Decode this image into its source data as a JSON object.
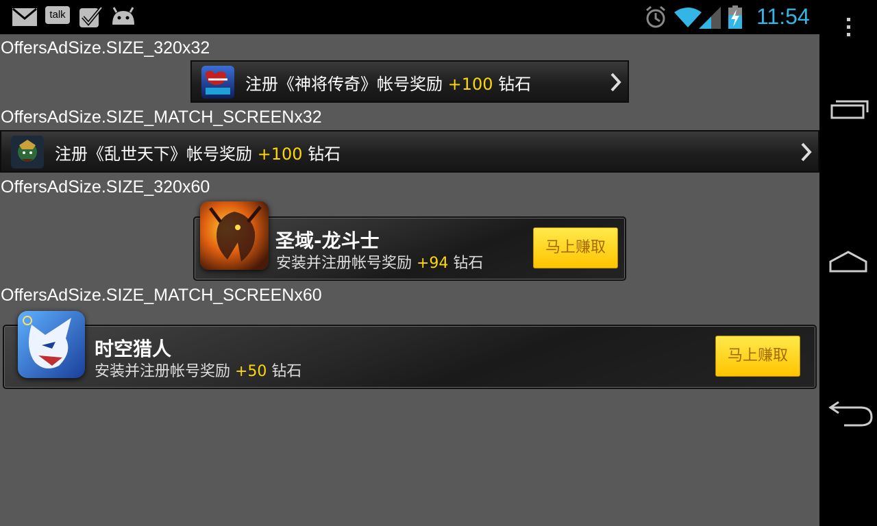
{
  "statusbar": {
    "talk_label": "talk",
    "time": "11:54",
    "icons": [
      "mail-icon",
      "talk-icon",
      "check-icon",
      "android-icon",
      "alarm-icon",
      "wifi-icon",
      "signal-icon",
      "battery-charging-icon"
    ]
  },
  "navbar": {
    "icons": [
      "overflow-menu-icon",
      "recent-apps-icon",
      "home-icon",
      "back-icon"
    ]
  },
  "sections": [
    {
      "label": "OffersAdSize.SIZE_320x32",
      "ad": {
        "prefix": "注册《神将传奇》帐号奖励 ",
        "reward": "+100",
        "suffix": " 钻石",
        "icon": "game-icon-shenjiang"
      }
    },
    {
      "label": "OffersAdSize.SIZE_MATCH_SCREENx32",
      "ad": {
        "prefix": "注册《乱世天下》帐号奖励 ",
        "reward": "+100",
        "suffix": " 钻石",
        "icon": "game-icon-luanshi"
      }
    },
    {
      "label": "OffersAdSize.SIZE_320x60",
      "ad": {
        "title": "圣域-龙斗士",
        "sub_prefix": "安装并注册帐号奖励 ",
        "reward": "+94",
        "sub_suffix": " 钻石",
        "button": "马上赚取",
        "icon": "game-icon-dragon"
      }
    },
    {
      "label": "OffersAdSize.SIZE_MATCH_SCREENx60",
      "ad": {
        "title": "时空猎人",
        "sub_prefix": "安装并注册帐号奖励 ",
        "reward": "+50",
        "sub_suffix": " 钻石",
        "button": "马上赚取",
        "icon": "game-icon-wolf"
      }
    }
  ],
  "colors": {
    "background": "#595959",
    "reward": "#ffd700",
    "clock": "#33b5e5",
    "button": "#ffc400"
  }
}
